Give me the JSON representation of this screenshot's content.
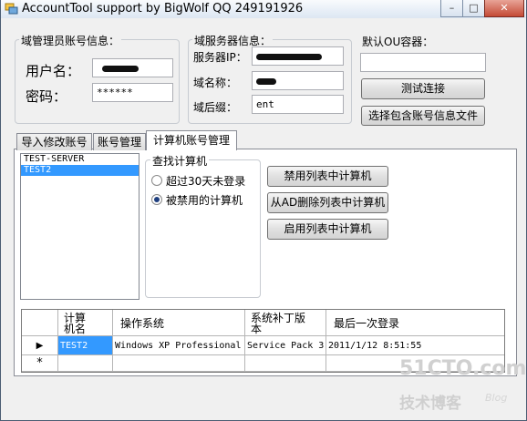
{
  "window": {
    "title": "AccountTool support by BigWolf QQ 249191926",
    "minimize": "–",
    "maximize": "□",
    "close": "✕"
  },
  "admin": {
    "group_label": "域管理员账号信息：",
    "username_label": "用户名：",
    "password_label": "密码：",
    "password_value": "******"
  },
  "server": {
    "group_label": "域服务器信息：",
    "ip_label": "服务器IP：",
    "domain_label": "域名称：",
    "suffix_label": "域后缀：",
    "suffix_value": "ent"
  },
  "ou": {
    "label": "默认OU容器：",
    "value": "",
    "test_button": "测试连接",
    "select_file_button": "选择包含账号信息文件"
  },
  "tabs": [
    {
      "label": "导入修改账号"
    },
    {
      "label": "账号管理"
    },
    {
      "label": "计算机账号管理"
    }
  ],
  "computer_list": [
    "TEST-SERVER",
    "TEST2"
  ],
  "find": {
    "group_label": "查找计算机",
    "option1": "超过30天未登录",
    "option2": "被禁用的计算机"
  },
  "actions": {
    "disable": "禁用列表中计算机",
    "delete": "从AD删除列表中计算机",
    "enable": "启用列表中计算机"
  },
  "grid": {
    "columns": [
      "计算机名",
      "操作系统",
      "系统补丁版本",
      "最后一次登录"
    ],
    "rows": [
      [
        "TEST2",
        "Windows XP Professional",
        "Service Pack 3",
        "2011/1/12 8:51:55"
      ]
    ],
    "current_row_marker": "▶",
    "new_row_marker": "*"
  },
  "watermark": {
    "site": "51CTO.com",
    "subtitle": "技术博客",
    "blog": "Blog"
  }
}
